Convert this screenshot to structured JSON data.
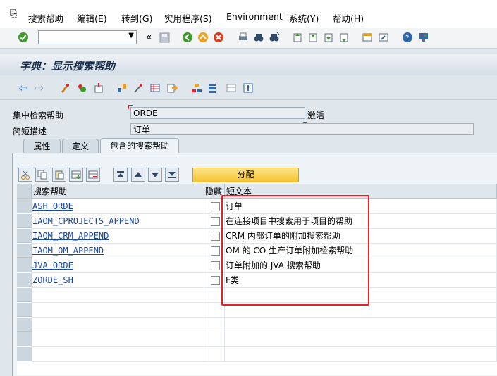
{
  "menubar": {
    "items": [
      {
        "label": "搜索帮助"
      },
      {
        "label": "编辑(E)"
      },
      {
        "label": "转到(G)"
      },
      {
        "label": "实用程序(S)"
      },
      {
        "label": "Environment"
      },
      {
        "label": "系统(Y)"
      },
      {
        "label": "帮助(H)"
      }
    ]
  },
  "stdbar": {
    "command_value": ""
  },
  "title": "字典：显示搜索帮助",
  "fields": {
    "collective_label": "集中检索帮助",
    "collective_value": "ORDE",
    "status": "激活",
    "desc_label": "简短描述",
    "desc_value": "订单"
  },
  "tabs": [
    {
      "label": "属性"
    },
    {
      "label": "定义"
    },
    {
      "label": "包含的搜索帮助"
    }
  ],
  "assign_button": "分配",
  "table": {
    "headers": {
      "col1": "搜索帮助",
      "col2": "隐藏",
      "col3": "短文本"
    },
    "rows": [
      {
        "name": "ASH_ORDE",
        "text": "订单"
      },
      {
        "name": "IAOM_CPROJECTS_APPEND",
        "text": "在连接项目中搜索用于项目的帮助"
      },
      {
        "name": "IAOM_CRM_APPEND",
        "text": "CRM 内部订单的附加搜索帮助"
      },
      {
        "name": "IAOM_OM_APPEND",
        "text": "OM 的 CO 生产订单附加检索帮助"
      },
      {
        "name": "JVA_ORDE",
        "text": "订单附加的 JVA 搜索帮助"
      },
      {
        "name": "ZORDE_SH",
        "text": "F类"
      }
    ]
  },
  "colors": {
    "accent_red": "#e8202a",
    "link": "#1a48a6",
    "button_yellow": "#f4c430"
  }
}
